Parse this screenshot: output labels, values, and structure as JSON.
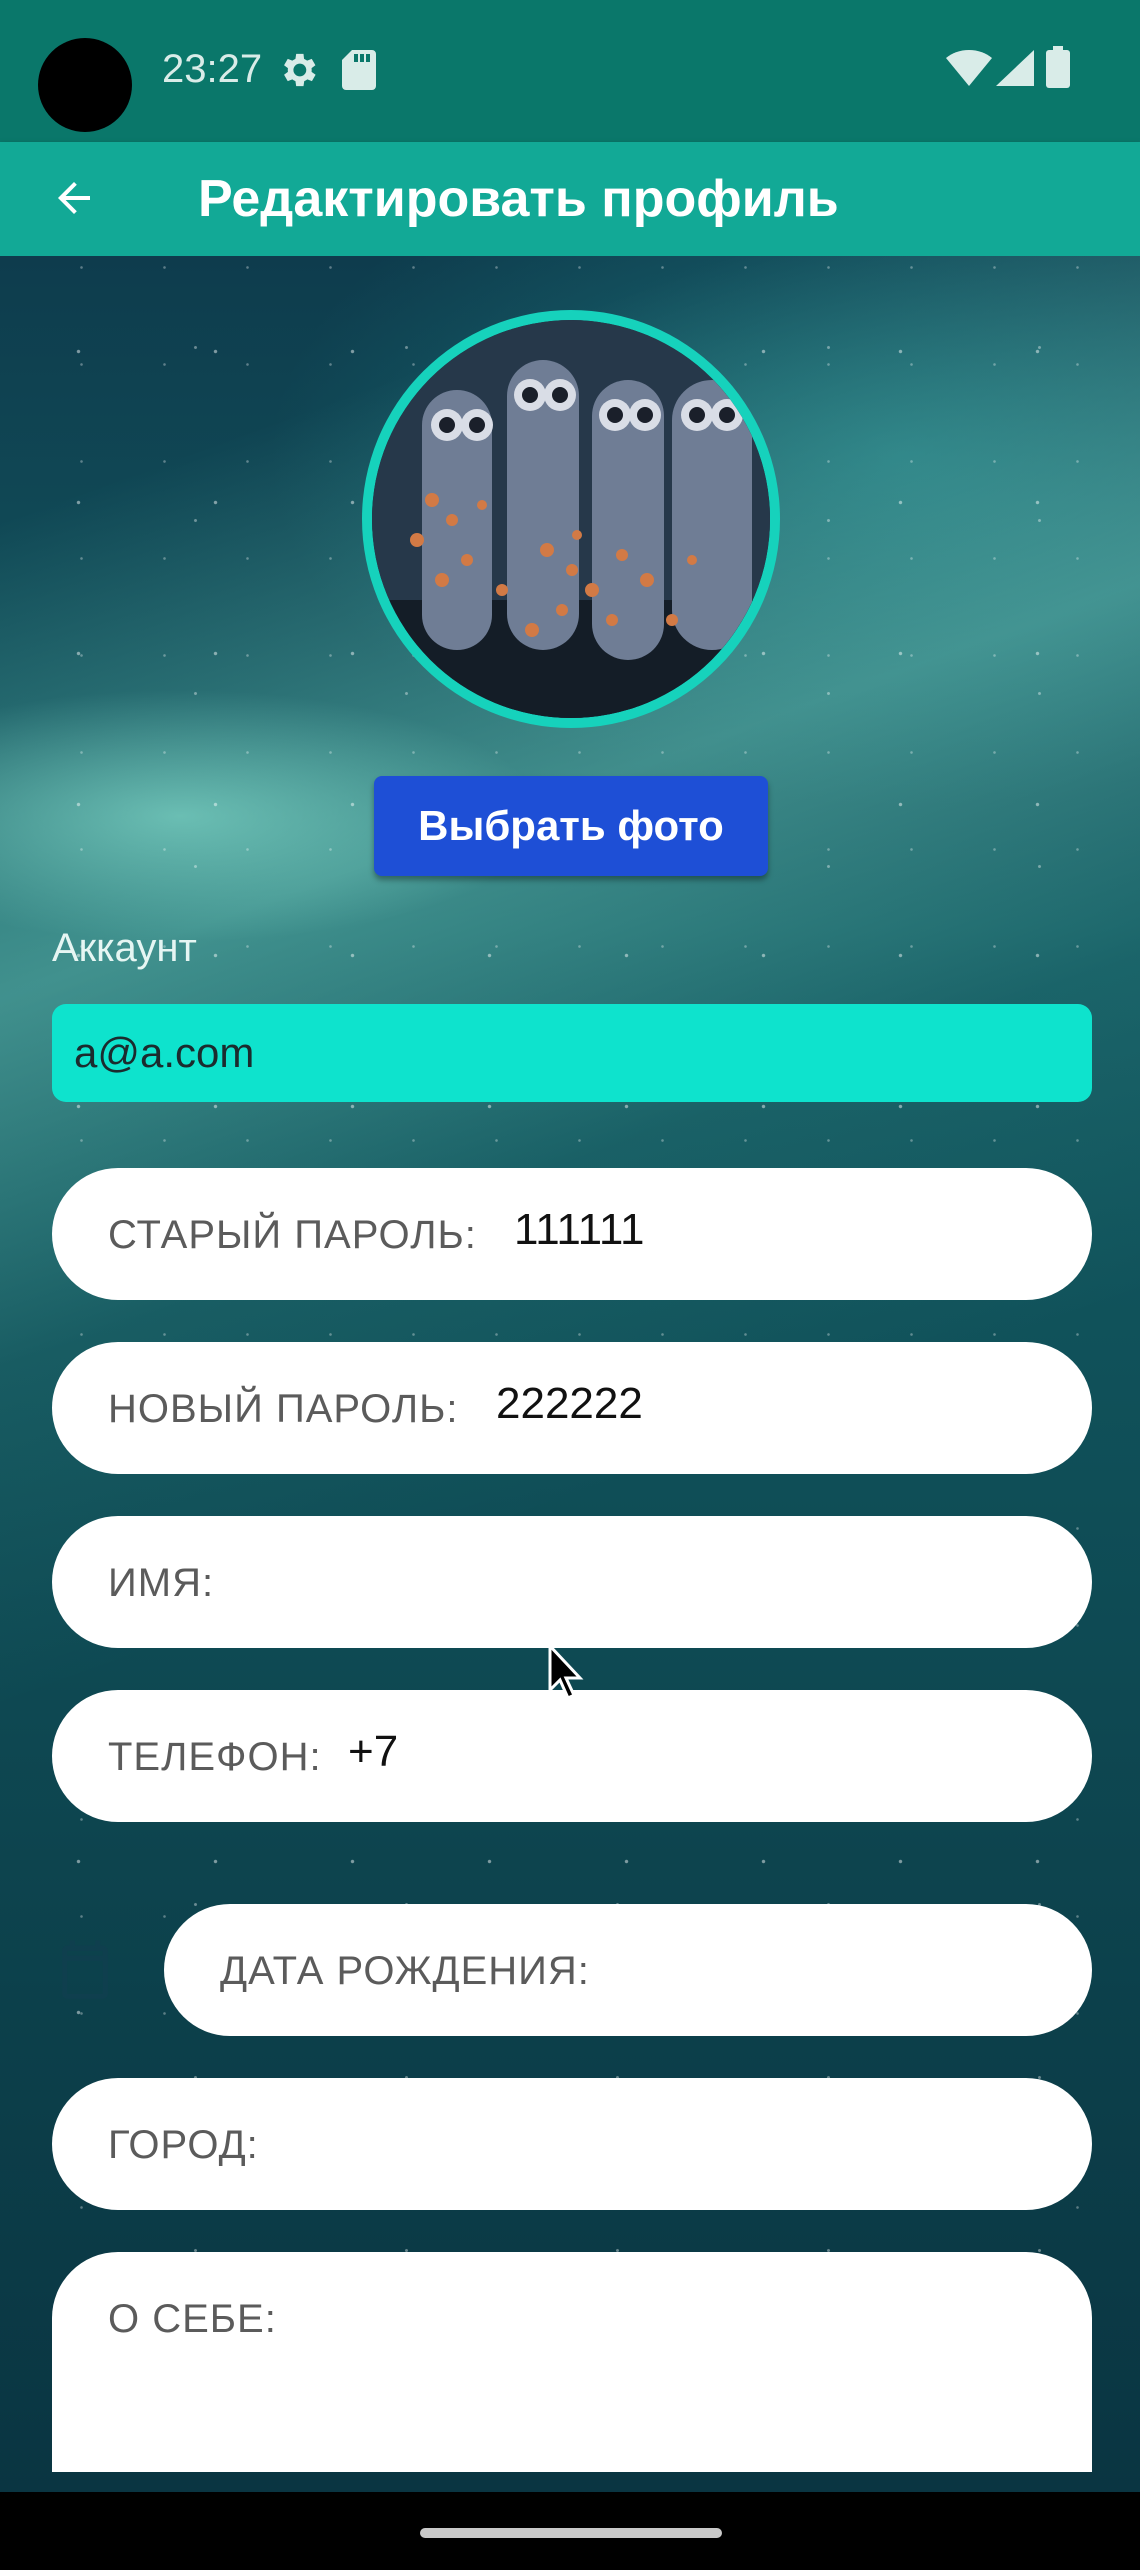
{
  "status_bar": {
    "time": "23:27",
    "icons": [
      "settings-gear-icon",
      "sd-card-icon",
      "wifi-icon",
      "signal-icon",
      "battery-icon"
    ]
  },
  "app_bar": {
    "title": "Редактировать профиль",
    "back_icon": "arrow-left-icon"
  },
  "profile": {
    "choose_photo_label": "Выбрать фото",
    "account_section_label": "Аккаунт",
    "account_email": "a@a.com"
  },
  "fields": {
    "old_password": {
      "label": "СТАРЫЙ ПАРОЛЬ:",
      "value": "111111"
    },
    "new_password": {
      "label": "НОВЫЙ ПАРОЛЬ:",
      "value": "222222"
    },
    "name": {
      "label": "ИМЯ:",
      "value": ""
    },
    "phone": {
      "label": "ТЕЛЕФОН:",
      "value": "+7"
    },
    "birth_date": {
      "label": "ДАТА РОЖДЕНИЯ:",
      "value": ""
    },
    "city": {
      "label": "ГОРОД:",
      "value": ""
    },
    "about": {
      "label": "О СЕБЕ:",
      "value": ""
    }
  },
  "colors": {
    "status_bar": "#0a776a",
    "app_bar": "#12a996",
    "avatar_ring": "#16d2bc",
    "account_field": "#0ee3cd",
    "primary_button": "#1e4fd6"
  }
}
